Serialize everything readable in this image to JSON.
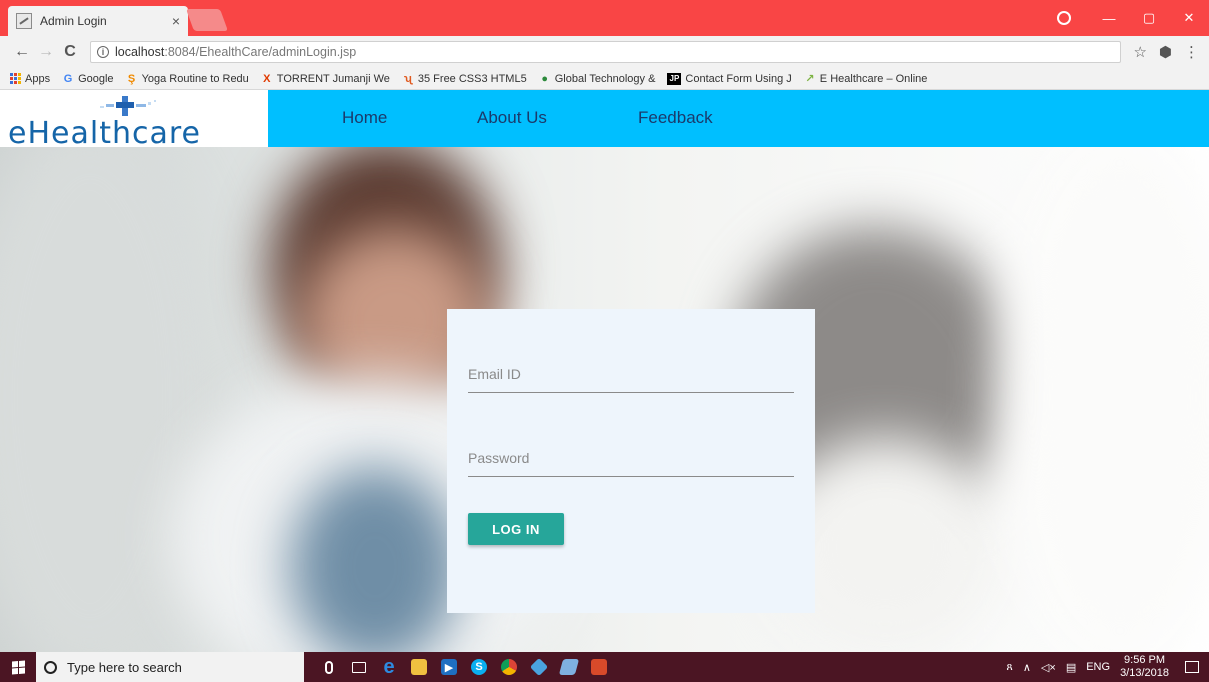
{
  "browser": {
    "tab": {
      "title": "Admin Login",
      "close": "×"
    },
    "window_controls": {
      "minimize": "—",
      "maximize": "▢",
      "close": "✕"
    },
    "address": {
      "host": "localhost",
      "path": ":8084/EhealthCare/adminLogin.jsp"
    },
    "nav": {
      "back": "←",
      "forward": "→",
      "reload": "C",
      "star": "☆",
      "ext": "⬢",
      "menu": "⋮"
    },
    "bookmarks": [
      {
        "label": "Apps",
        "icon": "apps-grid-icon"
      },
      {
        "label": "Google",
        "icon": "google-icon",
        "glyph": "G",
        "color": "#4285f4"
      },
      {
        "label": "Yoga Routine to Redu",
        "icon": "yoga-icon",
        "glyph": "Ş",
        "color": "#f08a00"
      },
      {
        "label": "TORRENT Jumanji We",
        "icon": "torrent-icon",
        "glyph": "X",
        "color": "#e03a00"
      },
      {
        "label": "35 Free CSS3 HTML5",
        "icon": "css3-icon",
        "glyph": "ʯ",
        "color": "#e05a20"
      },
      {
        "label": "Global Technology &",
        "icon": "globe-icon",
        "glyph": "●",
        "color": "#2c8a3c"
      },
      {
        "label": "Contact Form Using J",
        "icon": "jp-icon",
        "glyph": "JP",
        "color": "#000000"
      },
      {
        "label": "E Healthcare – Online",
        "icon": "ehealth-icon",
        "glyph": "↗",
        "color": "#7cb342"
      }
    ]
  },
  "site": {
    "logo_text": "eHealthcare",
    "nav": [
      {
        "label": "Home"
      },
      {
        "label": "About Us"
      },
      {
        "label": "Feedback"
      }
    ]
  },
  "login": {
    "email_placeholder": "Email ID",
    "password_placeholder": "Password",
    "button_label": "LOG IN"
  },
  "taskbar": {
    "search_placeholder": "Type here to search",
    "language": "ENG",
    "time": "9:56 PM",
    "date": "3/13/2018"
  },
  "colors": {
    "titlebar": "#f94545",
    "site_nav": "#00bfff",
    "login_button": "#26a69a",
    "taskbar": "#4b1523"
  }
}
